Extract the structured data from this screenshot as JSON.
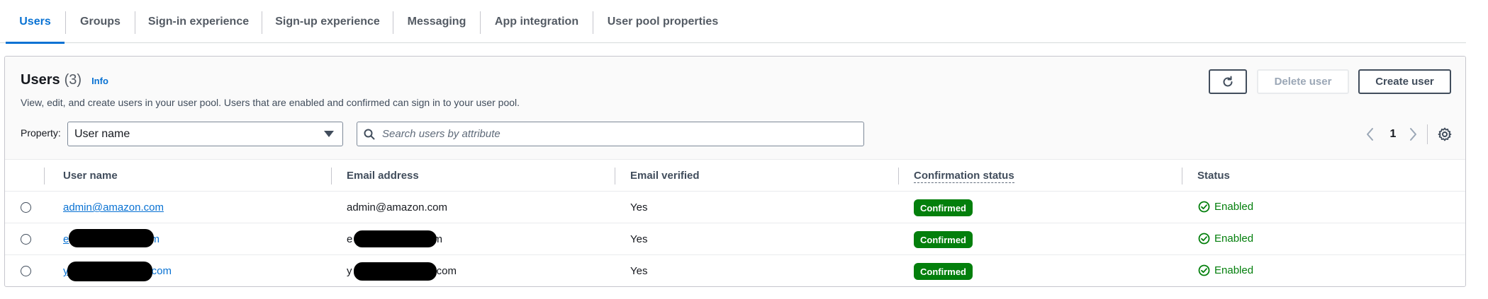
{
  "tabs": [
    {
      "label": "Users",
      "active": true
    },
    {
      "label": "Groups"
    },
    {
      "label": "Sign-in experience"
    },
    {
      "label": "Sign-up experience"
    },
    {
      "label": "Messaging"
    },
    {
      "label": "App integration"
    },
    {
      "label": "User pool properties"
    }
  ],
  "panel": {
    "title": "Users",
    "count": "(3)",
    "info_link": "Info",
    "description": "View, edit, and create users in your user pool. Users that are enabled and confirmed can sign in to your user pool.",
    "delete_button": "Delete user",
    "create_button": "Create user",
    "property_label": "Property:",
    "property_value": "User name",
    "search_placeholder": "Search users by attribute",
    "page": "1"
  },
  "table": {
    "headers": [
      "User name",
      "Email address",
      "Email verified",
      "Confirmation status",
      "Status"
    ],
    "rows": [
      {
        "username": "admin@amazon.com",
        "email": "admin@amazon.com",
        "verified": "Yes",
        "confirmation": "Confirmed",
        "status": "Enabled"
      },
      {
        "username": "e",
        "username_tail": "m",
        "email": "e",
        "email_tail": "m",
        "verified": "Yes",
        "confirmation": "Confirmed",
        "status": "Enabled"
      },
      {
        "username": "y",
        "username_tail": ".com",
        "email": "y",
        "email_tail": ".com",
        "verified": "Yes",
        "confirmation": "Confirmed",
        "status": "Enabled"
      }
    ]
  },
  "colors": {
    "accent": "#0972d3",
    "success": "#037f0c",
    "text": "#16191f",
    "muted": "#545b64"
  },
  "icons": [
    "refresh-icon",
    "search-icon",
    "chevron-left-icon",
    "chevron-right-icon",
    "gear-icon",
    "caret-down-icon",
    "check-circle-icon"
  ]
}
